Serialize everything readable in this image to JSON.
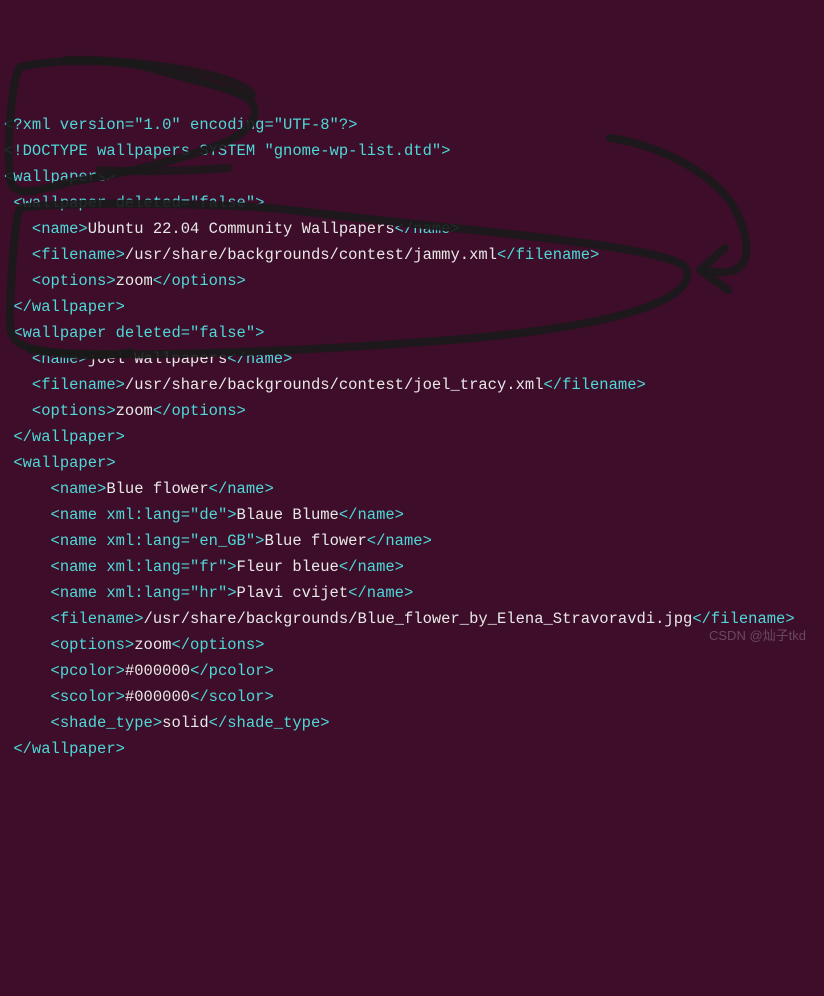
{
  "code": {
    "lines": [
      "<?xml version=\"1.0\" encoding=\"UTF-8\"?>",
      "<!DOCTYPE wallpapers SYSTEM \"gnome-wp-list.dtd\">",
      "<wallpapers>",
      " <wallpaper deleted=\"false\">",
      "   <name>Ubuntu 22.04 Community Wallpapers</name>",
      "   <filename>/usr/share/backgrounds/contest/jammy.xml</filename>",
      "   <options>zoom</options>",
      " </wallpaper>",
      " <wallpaper deleted=\"false\">",
      "   <name>joel Wallpapers</name>",
      "   <filename>/usr/share/backgrounds/contest/joel_tracy.xml</filename>",
      "   <options>zoom</options>",
      " </wallpaper>",
      " <wallpaper>",
      "     <name>Blue flower</name>",
      "     <name xml:lang=\"de\">Blaue Blume</name>",
      "     <name xml:lang=\"en_GB\">Blue flower</name>",
      "     <name xml:lang=\"fr\">Fleur bleue</name>",
      "     <name xml:lang=\"hr\">Plavi cvijet</name>",
      "     <filename>/usr/share/backgrounds/Blue_flower_by_Elena_Stravoravdi.jpg</filename>",
      "     <options>zoom</options>",
      "     <pcolor>#000000</pcolor>",
      "     <scolor>#000000</scolor>",
      "     <shade_type>solid</shade_type>",
      " </wallpaper>"
    ]
  },
  "watermark": "CSDN @灿子tkd"
}
